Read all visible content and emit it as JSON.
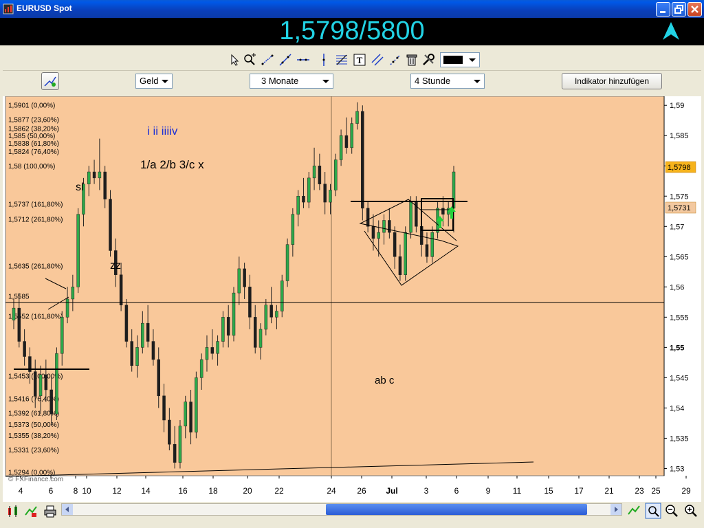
{
  "window": {
    "title": "EURUSD Spot"
  },
  "banner": {
    "price": "1,5798/5800",
    "arrow_color": "#22d3e5"
  },
  "toolbar": {
    "color_swatch": "#000000",
    "tools": [
      "pointer-icon",
      "zoom-icon",
      "line-icon",
      "trendline-icon",
      "horizontal-line-icon",
      "vertical-line-icon",
      "fibonacci-icon",
      "text-icon",
      "parallel-lines-icon",
      "channel-icon",
      "delete-icon",
      "settings-icon"
    ]
  },
  "controls": {
    "price_type": "Geld",
    "range": "3 Monate",
    "interval": "4 Stunde",
    "add_indicator": "Indikator hinzufügen"
  },
  "chart_data": {
    "type": "candlestick",
    "background": "#f9c89a",
    "y_ticks": [
      "1,59",
      "1,585",
      "1,58",
      "1,575",
      "1,57",
      "1,565",
      "1,56",
      "1,555",
      "1,55",
      "1,545",
      "1,54",
      "1,535",
      "1,53"
    ],
    "y_tick_values": [
      1.59,
      1.585,
      1.58,
      1.575,
      1.57,
      1.565,
      1.56,
      1.555,
      1.55,
      1.545,
      1.54,
      1.535,
      1.53
    ],
    "ylim": [
      1.5288,
      1.5915
    ],
    "x_ticks": [
      "4",
      "6",
      "8",
      "10",
      "12",
      "14",
      "16",
      "18",
      "20",
      "22",
      "24",
      "26",
      "Jul",
      "3",
      "6",
      "9",
      "11",
      "15",
      "17",
      "21",
      "23",
      "25",
      "29"
    ],
    "price_labels": [
      {
        "text": "1,5798",
        "value": 1.5798,
        "color": "#f6b31c"
      },
      {
        "text": "1,5731",
        "value": 1.5731,
        "color": "#f3c9a0"
      }
    ],
    "fib_levels_upper": [
      {
        "text": "1,5901 (0,00%)",
        "value": 1.5901
      },
      {
        "text": "1,5877 (23,60%)",
        "value": 1.5877
      },
      {
        "text": "1,5862 (38,20%)",
        "value": 1.5862
      },
      {
        "text": "1,585 (50,00%)",
        "value": 1.585
      },
      {
        "text": "1,5838 (61,80%)",
        "value": 1.5838
      },
      {
        "text": "1,5824 (76,40%)",
        "value": 1.5824
      },
      {
        "text": "1,58 (100,00%)",
        "value": 1.58
      },
      {
        "text": "1,5737 (161,80%)",
        "value": 1.5737
      },
      {
        "text": "1,5712 (261,80%)",
        "value": 1.5712
      },
      {
        "text": "1,5635 (261,80%)",
        "value": 1.5635
      },
      {
        "text": "1,5585",
        "value": 1.5585
      },
      {
        "text": "1,5552 (161,80%)",
        "value": 1.5552
      }
    ],
    "fib_levels_lower": [
      {
        "text": "1,5453 (100,00%)",
        "value": 1.5453
      },
      {
        "text": "1,5416 (76,40%)",
        "value": 1.5416
      },
      {
        "text": "1,5392 (61,80%)",
        "value": 1.5392
      },
      {
        "text": "1,5373 (50,00%)",
        "value": 1.5373
      },
      {
        "text": "1,5355 (38,20%)",
        "value": 1.5355
      },
      {
        "text": "1,5331 (23,60%)",
        "value": 1.5331
      },
      {
        "text": "1,5294 (0,00%)",
        "value": 1.5294
      }
    ],
    "annotations": [
      {
        "text": "i ii iiiiv",
        "color": "#1b2fd6"
      },
      {
        "text": "1/a  2/b   3/c  x",
        "color": "#000000"
      },
      {
        "text": "sl",
        "color": "#000000"
      },
      {
        "text": "zz",
        "color": "#000000"
      },
      {
        "text": "ab c",
        "color": "#000000"
      }
    ],
    "watermark": "© FXFinance.com",
    "candles": [
      [
        1.5545,
        1.558,
        1.553,
        1.5565
      ],
      [
        1.5565,
        1.559,
        1.55,
        1.551
      ],
      [
        1.551,
        1.553,
        1.547,
        1.5485
      ],
      [
        1.5485,
        1.55,
        1.544,
        1.546
      ],
      [
        1.546,
        1.548,
        1.54,
        1.542
      ],
      [
        1.542,
        1.547,
        1.539,
        1.5455
      ],
      [
        1.5455,
        1.548,
        1.541,
        1.543
      ],
      [
        1.543,
        1.545,
        1.537,
        1.539
      ],
      [
        1.539,
        1.55,
        1.538,
        1.549
      ],
      [
        1.549,
        1.556,
        1.547,
        1.555
      ],
      [
        1.555,
        1.56,
        1.554,
        1.558
      ],
      [
        1.558,
        1.562,
        1.556,
        1.56
      ],
      [
        1.56,
        1.573,
        1.559,
        1.572
      ],
      [
        1.572,
        1.578,
        1.57,
        1.577
      ],
      [
        1.577,
        1.58,
        1.575,
        1.579
      ],
      [
        1.579,
        1.581,
        1.577,
        1.578
      ],
      [
        1.578,
        1.5845,
        1.576,
        1.579
      ],
      [
        1.579,
        1.58,
        1.573,
        1.5745
      ],
      [
        1.5745,
        1.576,
        1.565,
        1.566
      ],
      [
        1.566,
        1.568,
        1.56,
        1.562
      ],
      [
        1.562,
        1.564,
        1.556,
        1.557
      ],
      [
        1.557,
        1.558,
        1.55,
        1.551
      ],
      [
        1.551,
        1.553,
        1.546,
        1.547
      ],
      [
        1.547,
        1.552,
        1.545,
        1.55
      ],
      [
        1.55,
        1.556,
        1.549,
        1.554
      ],
      [
        1.554,
        1.557,
        1.55,
        1.551
      ],
      [
        1.551,
        1.553,
        1.547,
        1.548
      ],
      [
        1.548,
        1.55,
        1.54,
        1.542
      ],
      [
        1.542,
        1.544,
        1.536,
        1.538
      ],
      [
        1.538,
        1.54,
        1.533,
        1.534
      ],
      [
        1.534,
        1.537,
        1.53,
        1.531
      ],
      [
        1.531,
        1.538,
        1.53,
        1.537
      ],
      [
        1.537,
        1.542,
        1.535,
        1.541
      ],
      [
        1.541,
        1.543,
        1.534,
        1.536
      ],
      [
        1.536,
        1.546,
        1.535,
        1.545
      ],
      [
        1.545,
        1.549,
        1.543,
        1.548
      ],
      [
        1.548,
        1.552,
        1.546,
        1.55
      ],
      [
        1.55,
        1.553,
        1.548,
        1.549
      ],
      [
        1.549,
        1.552,
        1.547,
        1.551
      ],
      [
        1.551,
        1.556,
        1.55,
        1.555
      ],
      [
        1.555,
        1.557,
        1.55,
        1.552
      ],
      [
        1.552,
        1.56,
        1.551,
        1.559
      ],
      [
        1.559,
        1.565,
        1.557,
        1.563
      ],
      [
        1.563,
        1.564,
        1.558,
        1.56
      ],
      [
        1.56,
        1.562,
        1.553,
        1.555
      ],
      [
        1.555,
        1.557,
        1.549,
        1.55
      ],
      [
        1.55,
        1.554,
        1.548,
        1.553
      ],
      [
        1.553,
        1.558,
        1.552,
        1.557
      ],
      [
        1.557,
        1.56,
        1.554,
        1.555
      ],
      [
        1.555,
        1.557,
        1.553,
        1.556
      ],
      [
        1.556,
        1.562,
        1.555,
        1.561
      ],
      [
        1.561,
        1.568,
        1.56,
        1.567
      ],
      [
        1.567,
        1.573,
        1.565,
        1.572
      ],
      [
        1.572,
        1.576,
        1.57,
        1.575
      ],
      [
        1.575,
        1.578,
        1.573,
        1.574
      ],
      [
        1.574,
        1.579,
        1.573,
        1.578
      ],
      [
        1.578,
        1.583,
        1.576,
        1.58
      ],
      [
        1.58,
        1.582,
        1.576,
        1.577
      ],
      [
        1.577,
        1.579,
        1.572,
        1.574
      ],
      [
        1.574,
        1.577,
        1.572,
        1.576
      ],
      [
        1.576,
        1.582,
        1.575,
        1.581
      ],
      [
        1.581,
        1.586,
        1.58,
        1.585
      ],
      [
        1.585,
        1.588,
        1.582,
        1.583
      ],
      [
        1.583,
        1.588,
        1.582,
        1.587
      ],
      [
        1.587,
        1.5905,
        1.586,
        1.589
      ],
      [
        1.589,
        1.59,
        1.571,
        1.573
      ],
      [
        1.573,
        1.574,
        1.569,
        1.57
      ],
      [
        1.57,
        1.572,
        1.566,
        1.568
      ],
      [
        1.568,
        1.571,
        1.565,
        1.569
      ],
      [
        1.569,
        1.572,
        1.567,
        1.571
      ],
      [
        1.571,
        1.573,
        1.568,
        1.569
      ],
      [
        1.569,
        1.57,
        1.563,
        1.565
      ],
      [
        1.565,
        1.567,
        1.561,
        1.562
      ],
      [
        1.562,
        1.57,
        1.561,
        1.569
      ],
      [
        1.569,
        1.575,
        1.568,
        1.574
      ],
      [
        1.574,
        1.575,
        1.569,
        1.57
      ],
      [
        1.57,
        1.571,
        1.565,
        1.567
      ],
      [
        1.567,
        1.569,
        1.564,
        1.565
      ],
      [
        1.565,
        1.57,
        1.564,
        1.569
      ],
      [
        1.569,
        1.574,
        1.568,
        1.573
      ],
      [
        1.573,
        1.575,
        1.57,
        1.572
      ],
      [
        1.572,
        1.574,
        1.57,
        1.573
      ],
      [
        1.573,
        1.58,
        1.569,
        1.579
      ]
    ]
  },
  "bottombar": {
    "left_tools": [
      "candlestick-chart-icon",
      "indicator-icon",
      "print-icon"
    ],
    "right_tools": [
      "crosshair-zoom-icon",
      "zoom-out-icon",
      "zoom-in-icon"
    ]
  }
}
